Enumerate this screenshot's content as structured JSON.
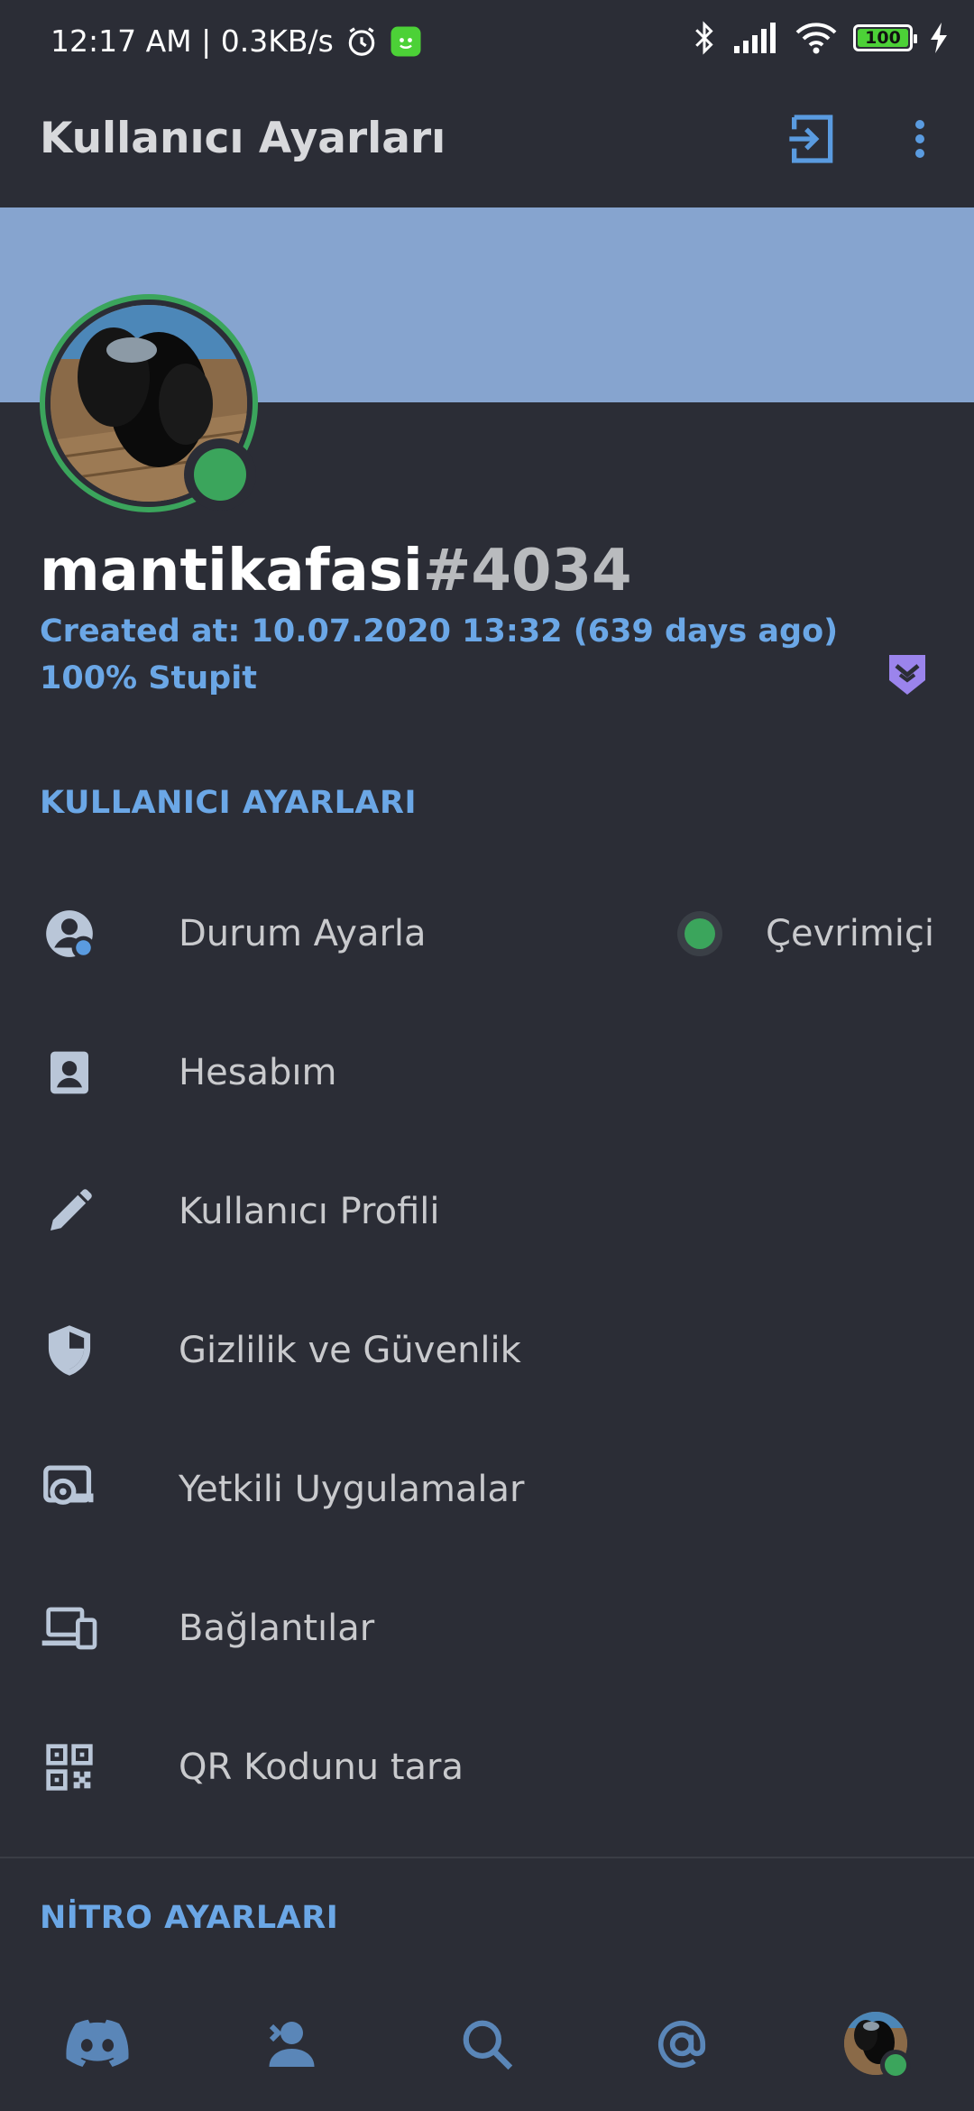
{
  "status_bar": {
    "time_speed": "12:17 AM | 0.3KB/s",
    "battery": "100"
  },
  "app_bar": {
    "title": "Kullanıcı Ayarları"
  },
  "profile": {
    "username": "mantikafasi",
    "discriminator": "#4034",
    "created_at": "Created at: 10.07.2020 13:32 (639 days ago)",
    "bio": "100% Stupit"
  },
  "sections": {
    "user_settings": "KULLANICI AYARLARI",
    "nitro_settings": "NİTRO AYARLARI"
  },
  "menu": {
    "set_status": "Durum Ayarla",
    "status_value": "Çevrimiçi",
    "my_account": "Hesabım",
    "user_profile": "Kullanıcı Profili",
    "privacy_safety": "Gizlilik ve Güvenlik",
    "authorized_apps": "Yetkili Uygulamalar",
    "connections": "Bağlantılar",
    "scan_qr": "QR Kodunu tara"
  },
  "colors": {
    "background": "#2b2d36",
    "banner": "#86a4cf",
    "accent_blue": "#6ba7e6",
    "online_green": "#3ba55c",
    "hypesquad": "#9b84ec"
  },
  "icons": {
    "bottom_nav": [
      "discord-home-icon",
      "friends-icon",
      "search-icon",
      "mentions-icon",
      "user-avatar"
    ]
  }
}
